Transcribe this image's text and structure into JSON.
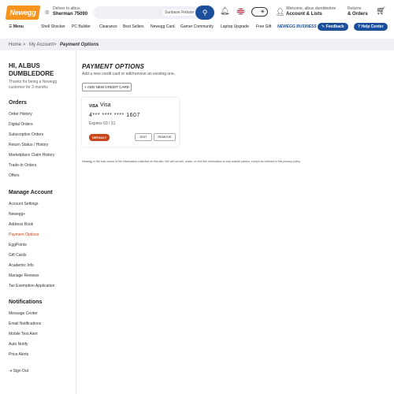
{
  "header": {
    "logo_text": "Newegg",
    "deliver_line1": "Deliver to albus",
    "deliver_line2": "Sherman 75090",
    "search_placeholder": "Sunbase Rebate",
    "welcome_line1": "Welcome, albus dumbledore",
    "welcome_line2": "Account & Lists",
    "returns_line1": "Returns",
    "returns_line2": "& Orders",
    "brand_color": "#f7931e",
    "accent_color": "#1b4f9c"
  },
  "nav": {
    "menu": "Menu",
    "items": [
      "Shell Shocker",
      "PC Builder",
      "Clearance",
      "Best Sellers",
      "Newegg Card",
      "Gamer Community",
      "Laptop Upgrade",
      "Free Gift"
    ],
    "business": "NEWEGG BUSINESS",
    "feedback": "Feedback",
    "help": "Help Center"
  },
  "breadcrumb": {
    "home": "Home",
    "my_account": "My Account",
    "current": "Payment Options"
  },
  "sidebar": {
    "greeting": "HI, ALBUS DUMBLEDORE",
    "thanks": "Thanks for being a Newegg customer for 3 months",
    "orders_title": "Orders",
    "orders": [
      "Order History",
      "Digital Orders",
      "Subscription Orders",
      "Return Status / History",
      "Marketplace Claim History",
      "Trade-In Orders",
      "Offers"
    ],
    "manage_title": "Manage Account",
    "manage": [
      "Account Settings",
      "Newegg+",
      "Address Book",
      "Payment Options",
      "EggPoints",
      "Gift Cards",
      "Academic Info",
      "Manage Reviews",
      "Tax Exemption Application"
    ],
    "notif_title": "Notifications",
    "notif": [
      "Message Center",
      "Email Notifications",
      "Mobile Text Alert",
      "Auto Notify",
      "Price Alerts"
    ],
    "signout": "Sign Out",
    "active_color": "#c8461a"
  },
  "main": {
    "title": "PAYMENT OPTIONS",
    "subtitle": "Add a new credit card or edit/remove an existing one.",
    "add_button": "+ ADD NEW CREDIT CARD",
    "card": {
      "brand_logo": "VISA",
      "name": "Visa",
      "number": "4*** **** **** 1607",
      "expires": "Expires 03 / 31",
      "default_badge": "DEFAULT",
      "edit": "EDIT",
      "remove": "REMOVE"
    },
    "disclaimer": "Newegg is the sole owner of the information collected on this site. We will not sell, share, or rent this information to any outside parties, except as outlined in this privacy policy."
  }
}
